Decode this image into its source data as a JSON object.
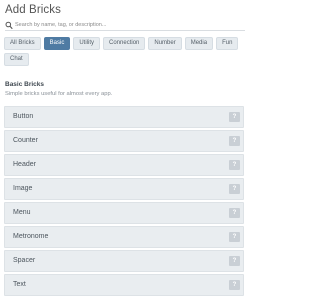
{
  "panel": {
    "title": "Add Bricks"
  },
  "search": {
    "placeholder": "Search by name, tag, or description..."
  },
  "filters": [
    {
      "label": "All Bricks",
      "active": false
    },
    {
      "label": "Basic",
      "active": true
    },
    {
      "label": "Utility",
      "active": false
    },
    {
      "label": "Connection",
      "active": false
    },
    {
      "label": "Number",
      "active": false
    },
    {
      "label": "Media",
      "active": false
    },
    {
      "label": "Fun",
      "active": false
    },
    {
      "label": "Chat",
      "active": false
    }
  ],
  "section": {
    "title": "Basic Bricks",
    "subtitle": "Simple bricks useful for almost every app."
  },
  "bricks": [
    {
      "label": "Button",
      "help": "?"
    },
    {
      "label": "Counter",
      "help": "?"
    },
    {
      "label": "Header",
      "help": "?"
    },
    {
      "label": "Image",
      "help": "?"
    },
    {
      "label": "Menu",
      "help": "?"
    },
    {
      "label": "Metronome",
      "help": "?"
    },
    {
      "label": "Spacer",
      "help": "?"
    },
    {
      "label": "Text",
      "help": "?"
    }
  ],
  "colors": {
    "accent": "#4f7ba3",
    "chip_bg": "#e6ebef",
    "row_bg": "#e9edf0"
  }
}
